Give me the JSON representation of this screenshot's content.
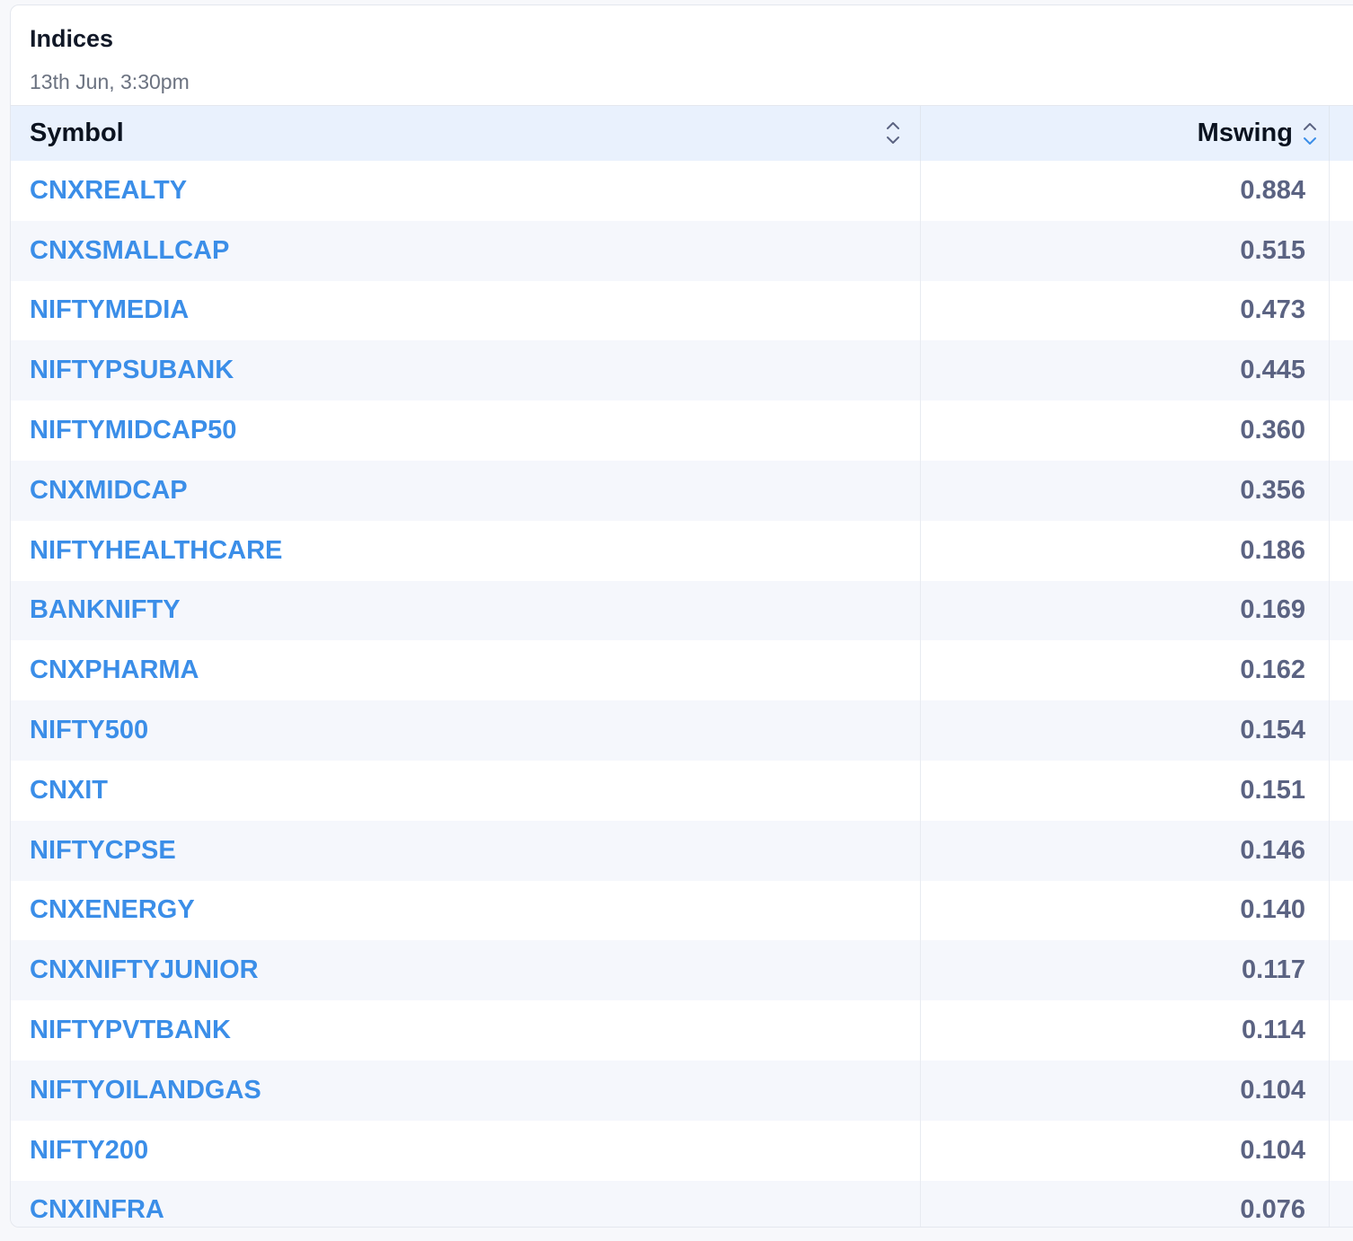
{
  "card": {
    "title": "Indices",
    "subtitle": "13th Jun, 3:30pm"
  },
  "table": {
    "columns": {
      "symbol": "Symbol",
      "mswing": "Mswing"
    },
    "sort_icons": {
      "symbol": "sort-neutral-icon",
      "mswing": "sort-active-icon"
    },
    "colors": {
      "link": "#3b8ee8",
      "value": "#5b6382",
      "header_bg": "#e9f1fd",
      "sort_active": "#3b8ee8"
    },
    "rows": [
      {
        "symbol": "CNXREALTY",
        "mswing": "0.884"
      },
      {
        "symbol": "CNXSMALLCAP",
        "mswing": "0.515"
      },
      {
        "symbol": "NIFTYMEDIA",
        "mswing": "0.473"
      },
      {
        "symbol": "NIFTYPSUBANK",
        "mswing": "0.445"
      },
      {
        "symbol": "NIFTYMIDCAP50",
        "mswing": "0.360"
      },
      {
        "symbol": "CNXMIDCAP",
        "mswing": "0.356"
      },
      {
        "symbol": "NIFTYHEALTHCARE",
        "mswing": "0.186"
      },
      {
        "symbol": "BANKNIFTY",
        "mswing": "0.169"
      },
      {
        "symbol": "CNXPHARMA",
        "mswing": "0.162"
      },
      {
        "symbol": "NIFTY500",
        "mswing": "0.154"
      },
      {
        "symbol": "CNXIT",
        "mswing": "0.151"
      },
      {
        "symbol": "NIFTYCPSE",
        "mswing": "0.146"
      },
      {
        "symbol": "CNXENERGY",
        "mswing": "0.140"
      },
      {
        "symbol": "CNXNIFTYJUNIOR",
        "mswing": "0.117"
      },
      {
        "symbol": "NIFTYPVTBANK",
        "mswing": "0.114"
      },
      {
        "symbol": "NIFTYOILANDGAS",
        "mswing": "0.104"
      },
      {
        "symbol": "NIFTY200",
        "mswing": "0.104"
      },
      {
        "symbol": "CNXINFRA",
        "mswing": "0.076"
      }
    ]
  }
}
